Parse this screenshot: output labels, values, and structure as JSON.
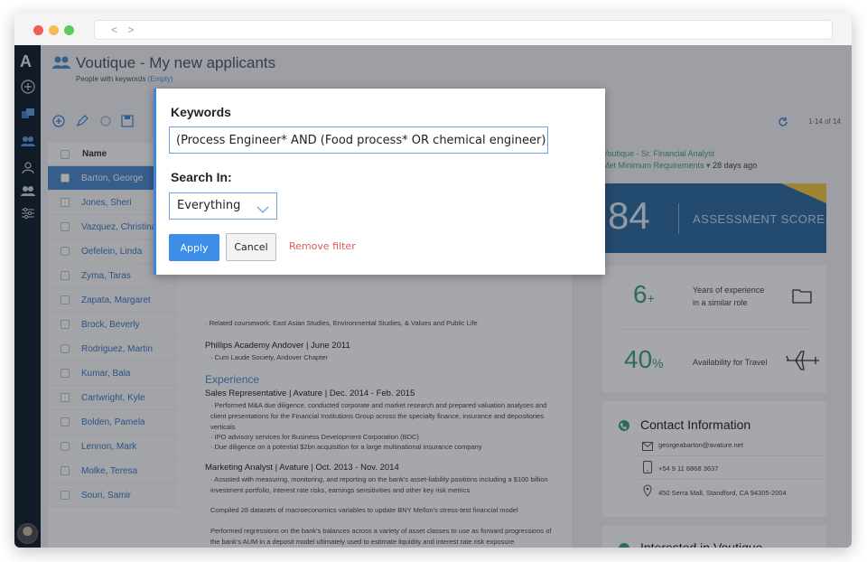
{
  "app": {
    "logo": "A",
    "title": "Voutique - My new applicants",
    "subtitle_prefix": "People with keywords",
    "subtitle_empty": "(Empty)",
    "pager": "1-14 of 14"
  },
  "list": {
    "header": "Name",
    "rows": [
      {
        "name": "Barton, George",
        "selected": true
      },
      {
        "name": "Jones, Sheri"
      },
      {
        "name": "Vazquez, Christina"
      },
      {
        "name": "Oefelein, Linda"
      },
      {
        "name": "Zyma, Taras"
      },
      {
        "name": "Zapata, Margaret"
      },
      {
        "name": "Brock, Beverly"
      },
      {
        "name": "Rodriguez, Martin"
      },
      {
        "name": "Kumar, Bala"
      },
      {
        "name": "Cartwright, Kyle"
      },
      {
        "name": "Bolden, Pamela"
      },
      {
        "name": "Lennon, Mark"
      },
      {
        "name": "Molke, Teresa"
      },
      {
        "name": "Souri, Samir"
      }
    ]
  },
  "resume": {
    "coursework": "· Related coursework: East Asian Studies, Environmental Studies, & Values and Public Life",
    "school": "Phillips Academy Andover | June 2011",
    "school_note": "· Cum Laude Society, Andover Chapter",
    "experience_heading": "Experience",
    "job1": "Sales Representative | Avature | Dec. 2014 - Feb. 2015",
    "job1_b1": "· Performed M&A due diligence, conducted corporate and market research and prepared valuation analyses and client presentations for the Financial Institutions Group across the specialty finance, insurance and depositories verticals",
    "job1_b2": "· IPO advisory services for Business Development Corporation (BDC)",
    "job1_b3": "· Due diligence on a potential $2bn acquisition for a large multinational insurance company",
    "job2": "Marketing Analyst | Avature | Oct. 2013 - Nov. 2014",
    "job2_b1": "· Assisted with measuring, monitoring, and reporting on the bank's asset-liability positions including a $100 billion investment portfolio, interest rate risks, earnings sensitivities and other key risk metrics",
    "job2_b2": "Compiled 28 datasets of macroeconomics variables to update BNY Mellon's stress-test financial model",
    "job2_b3": "Performed regressions on the bank's balances across a variety of asset classes to use as forward progressions of the bank's AUM in a deposit model ultimately used to estimate liquidity and interest rate risk exposure"
  },
  "right": {
    "job_title": "Voutique - Sr. Financial Analyst",
    "status": "Met Minimum Requirements",
    "ago": "28 days ago",
    "score": "84",
    "score_label": "ASSESSMENT SCORE",
    "exp_value": "6",
    "exp_suffix": "+",
    "exp_label_1": "Years of experience",
    "exp_label_2": "in a similar role",
    "travel_value": "40",
    "travel_suffix": "%",
    "travel_label": "Availability for Travel",
    "contact_title": "Contact Information",
    "email": "georgeabarton@avature.net",
    "phone": "+54 9 11 6868 3637",
    "address": "450 Serra Mall, Standford, CA 94305-2004",
    "interest_title": "Interested in Voutique"
  },
  "modal": {
    "keywords_label": "Keywords",
    "keywords_value": "(Process Engineer* AND (Food process* OR chemical engineer))",
    "search_in_label": "Search In:",
    "search_in_value": "Everything",
    "apply": "Apply",
    "cancel": "Cancel",
    "remove": "Remove filter"
  },
  "colors": {
    "accent": "#3d8ee8",
    "rail": "#101c2c",
    "green": "#3aa07d",
    "banner": "#2d6aa0",
    "danger": "#e05a5a"
  }
}
